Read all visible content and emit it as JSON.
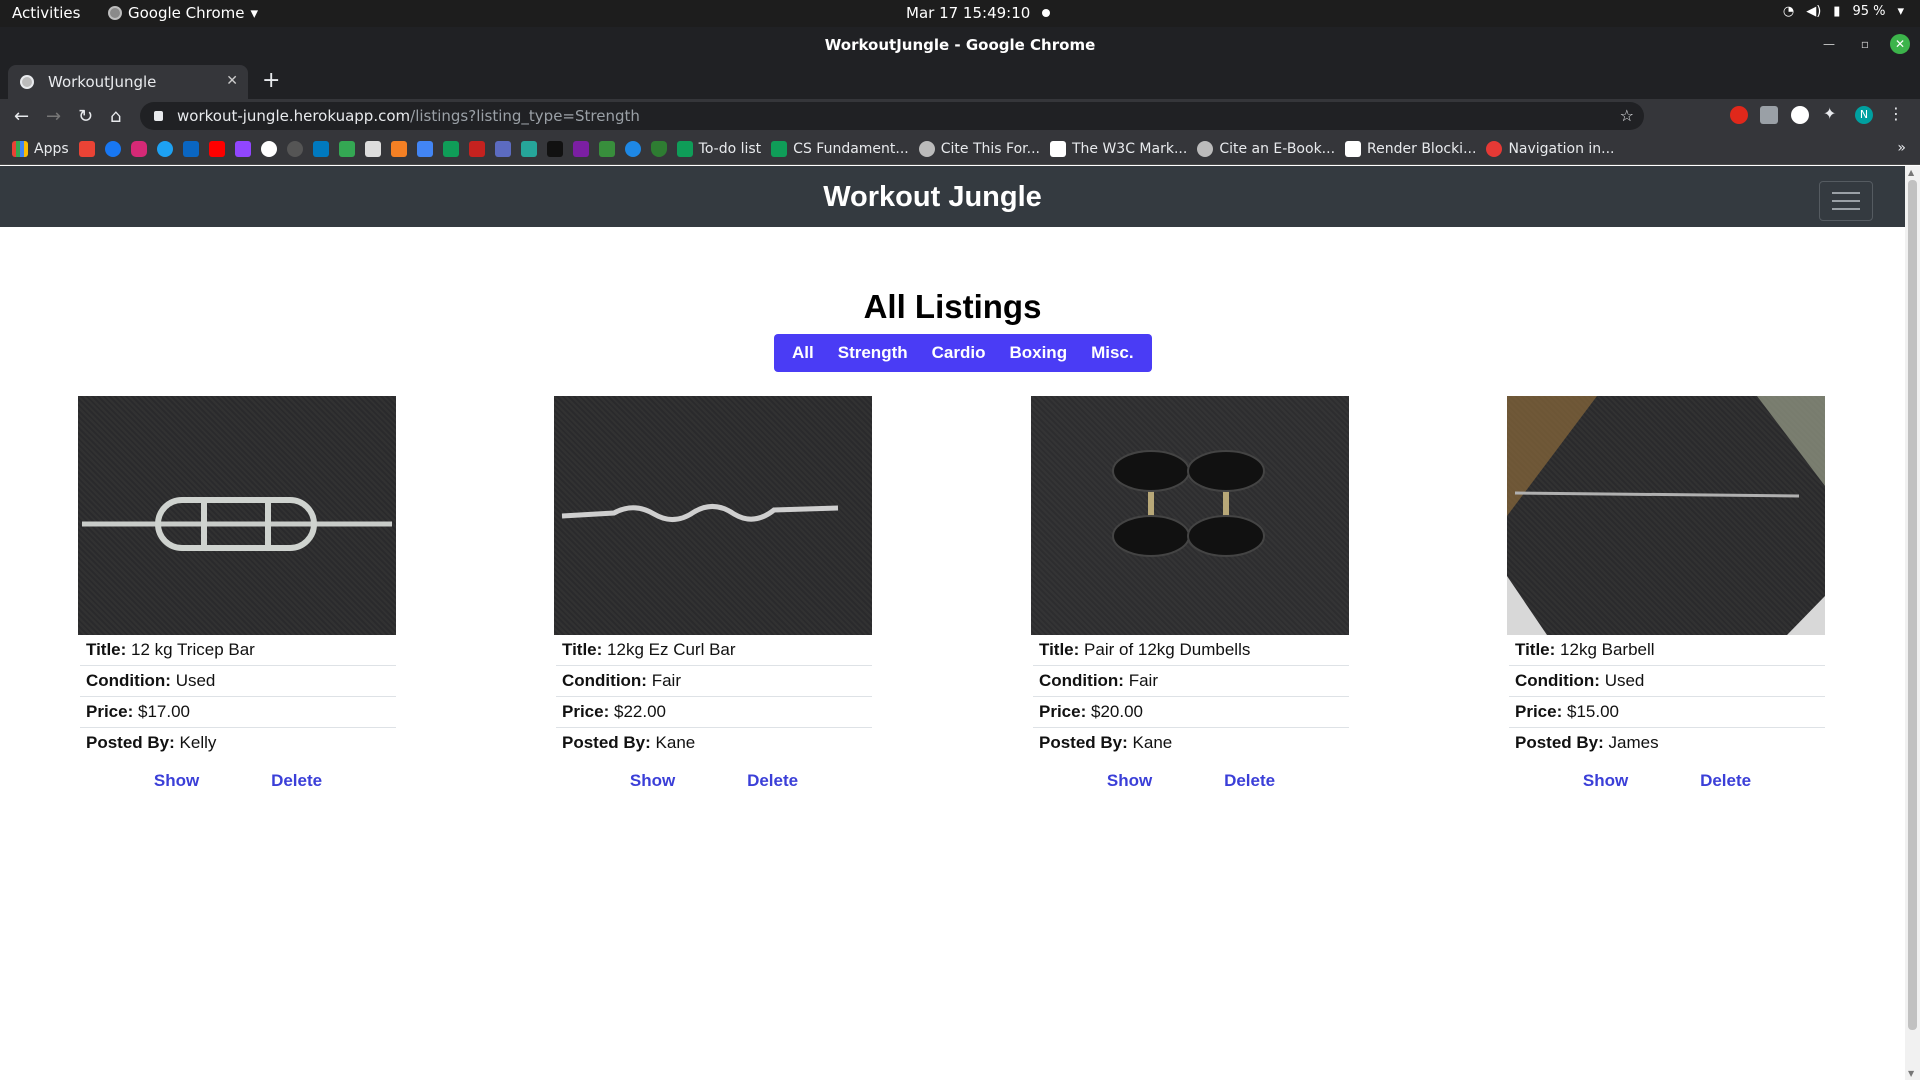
{
  "os": {
    "activities": "Activities",
    "app_name": "Google Chrome",
    "clock": "Mar 17  15:49:10",
    "battery": "95 %"
  },
  "window": {
    "title": "WorkoutJungle - Google Chrome"
  },
  "tab": {
    "title": "WorkoutJungle"
  },
  "address": {
    "host": "workout-jungle.herokuapp.com",
    "path": "/listings?listing_type=Strength"
  },
  "bookmarks": {
    "apps": "Apps",
    "items": [
      "To-do list",
      "CS Fundament...",
      "Cite This For...",
      "The W3C Mark...",
      "Cite an E-Book...",
      "Render Blocki...",
      "Navigation in..."
    ]
  },
  "site": {
    "brand": "Workout Jungle",
    "page_title": "All Listings",
    "filters": [
      "All",
      "Strength",
      "Cardio",
      "Boxing",
      "Misc."
    ],
    "labels": {
      "title": "Title:",
      "condition": "Condition:",
      "price": "Price:",
      "posted_by": "Posted By:"
    },
    "actions": {
      "show": "Show",
      "delete": "Delete"
    },
    "listings": [
      {
        "title": "12 kg Tricep Bar",
        "condition": "Used",
        "price": "$17.00",
        "posted_by": "Kelly"
      },
      {
        "title": "12kg Ez Curl Bar",
        "condition": "Fair",
        "price": "$22.00",
        "posted_by": "Kane"
      },
      {
        "title": "Pair of 12kg Dumbells",
        "condition": "Fair",
        "price": "$20.00",
        "posted_by": "Kane"
      },
      {
        "title": "12kg Barbell",
        "condition": "Used",
        "price": "$15.00",
        "posted_by": "James"
      }
    ]
  },
  "colors": {
    "navbar": "#343a40",
    "filter_bg": "#4a3cf5",
    "link": "#3b3fd8"
  }
}
